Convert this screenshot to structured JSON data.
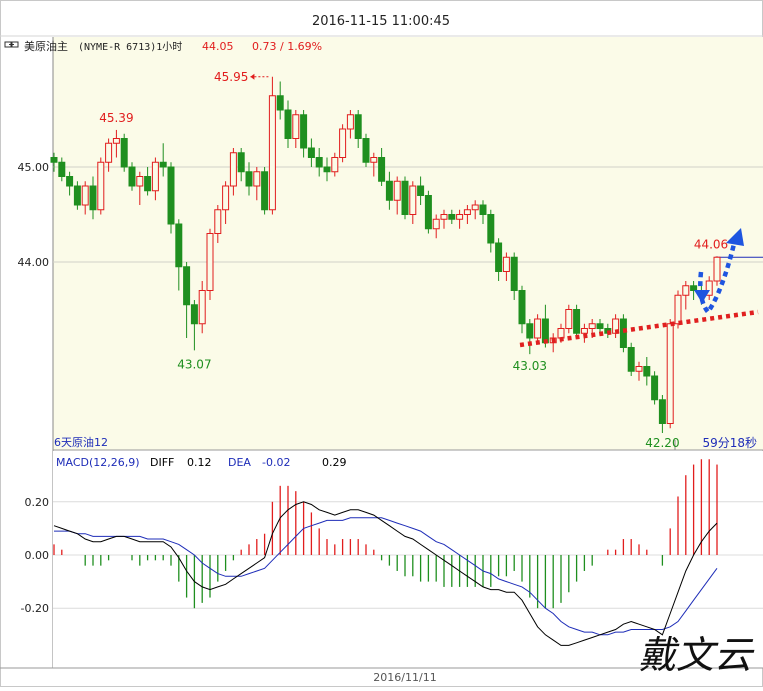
{
  "datetime": "2016-11-15 11:00:45",
  "header": {
    "instrument": "美原油主",
    "code": "(NYME-R 6713)1小时",
    "last_price": "44.05",
    "change": "0.73 / 1.69%"
  },
  "price_axis": {
    "ticks": [
      "45.00",
      "44.00"
    ]
  },
  "price_labels": {
    "p1": "45.39",
    "p2": "45.95",
    "p3": "43.07",
    "p4": "43.03",
    "p5": "42.20",
    "p6": "44.06"
  },
  "footer_left": "6天原油12",
  "countdown": "59分18秒",
  "macd": {
    "label": "MACD(12,26,9)",
    "diff_label": "DIFF",
    "diff_value": "0.12",
    "dea_label": "DEA",
    "dea_value": "-0.02",
    "macd_value": "0.29",
    "ticks": [
      "0.20",
      "0.00",
      "-0.20"
    ]
  },
  "date_label": "2016/11/11",
  "watermark": "戴文云",
  "colors": {
    "up": "#e11d1d",
    "down": "#1f8f1f",
    "diff": "#000000",
    "dea": "#1e2db8",
    "trend_up": "#e02020",
    "projection": "#1e55e0"
  },
  "chart_data": {
    "type": "candlestick",
    "title": "",
    "ylim": [
      42.0,
      46.0
    ],
    "grid": true,
    "levels": [
      45.0,
      44.0
    ],
    "candles": [
      [
        45.1,
        45.15,
        44.95,
        45.05
      ],
      [
        45.05,
        45.1,
        44.85,
        44.9
      ],
      [
        44.9,
        44.95,
        44.7,
        44.8
      ],
      [
        44.8,
        44.85,
        44.55,
        44.6
      ],
      [
        44.6,
        44.85,
        44.5,
        44.8
      ],
      [
        44.8,
        44.9,
        44.45,
        44.55
      ],
      [
        44.55,
        45.1,
        44.5,
        45.05
      ],
      [
        45.05,
        45.3,
        44.95,
        45.25
      ],
      [
        45.25,
        45.39,
        45.1,
        45.3
      ],
      [
        45.3,
        45.35,
        44.95,
        45.0
      ],
      [
        45.0,
        45.05,
        44.75,
        44.8
      ],
      [
        44.8,
        44.95,
        44.6,
        44.9
      ],
      [
        44.9,
        45.0,
        44.7,
        44.75
      ],
      [
        44.75,
        45.1,
        44.65,
        45.05
      ],
      [
        45.05,
        45.25,
        44.9,
        45.0
      ],
      [
        45.0,
        45.05,
        44.3,
        44.4
      ],
      [
        44.4,
        44.45,
        43.7,
        43.95
      ],
      [
        43.95,
        44.0,
        43.2,
        43.55
      ],
      [
        43.55,
        43.6,
        43.07,
        43.35
      ],
      [
        43.35,
        43.8,
        43.25,
        43.7
      ],
      [
        43.7,
        44.35,
        43.6,
        44.3
      ],
      [
        44.3,
        44.6,
        44.2,
        44.55
      ],
      [
        44.55,
        44.85,
        44.4,
        44.8
      ],
      [
        44.8,
        45.2,
        44.7,
        45.15
      ],
      [
        45.15,
        45.2,
        44.85,
        44.95
      ],
      [
        44.95,
        45.05,
        44.7,
        44.8
      ],
      [
        44.8,
        45.0,
        44.65,
        44.95
      ],
      [
        44.95,
        45.0,
        44.5,
        44.55
      ],
      [
        44.55,
        45.95,
        44.5,
        45.75
      ],
      [
        45.75,
        45.9,
        45.5,
        45.6
      ],
      [
        45.6,
        45.7,
        45.2,
        45.3
      ],
      [
        45.3,
        45.6,
        45.2,
        45.55
      ],
      [
        45.55,
        45.6,
        45.1,
        45.2
      ],
      [
        45.2,
        45.3,
        45.0,
        45.1
      ],
      [
        45.1,
        45.2,
        44.9,
        45.0
      ],
      [
        45.0,
        45.1,
        44.85,
        44.95
      ],
      [
        44.95,
        45.15,
        44.9,
        45.1
      ],
      [
        45.1,
        45.45,
        45.05,
        45.4
      ],
      [
        45.4,
        45.6,
        45.3,
        45.55
      ],
      [
        45.55,
        45.6,
        45.2,
        45.3
      ],
      [
        45.3,
        45.35,
        45.0,
        45.05
      ],
      [
        45.05,
        45.15,
        44.9,
        45.1
      ],
      [
        45.1,
        45.2,
        44.8,
        44.85
      ],
      [
        44.85,
        44.95,
        44.55,
        44.65
      ],
      [
        44.65,
        44.9,
        44.5,
        44.85
      ],
      [
        44.85,
        44.9,
        44.45,
        44.5
      ],
      [
        44.5,
        44.85,
        44.4,
        44.8
      ],
      [
        44.8,
        44.9,
        44.6,
        44.7
      ],
      [
        44.7,
        44.75,
        44.3,
        44.35
      ],
      [
        44.35,
        44.5,
        44.25,
        44.45
      ],
      [
        44.45,
        44.55,
        44.35,
        44.5
      ],
      [
        44.5,
        44.55,
        44.4,
        44.45
      ],
      [
        44.45,
        44.55,
        44.35,
        44.5
      ],
      [
        44.5,
        44.6,
        44.4,
        44.55
      ],
      [
        44.55,
        44.65,
        44.45,
        44.6
      ],
      [
        44.6,
        44.65,
        44.4,
        44.5
      ],
      [
        44.5,
        44.55,
        44.1,
        44.2
      ],
      [
        44.2,
        44.25,
        43.8,
        43.9
      ],
      [
        43.9,
        44.1,
        43.8,
        44.05
      ],
      [
        44.05,
        44.1,
        43.6,
        43.7
      ],
      [
        43.7,
        43.75,
        43.25,
        43.35
      ],
      [
        43.35,
        43.4,
        43.03,
        43.2
      ],
      [
        43.2,
        43.45,
        43.15,
        43.4
      ],
      [
        43.4,
        43.55,
        43.1,
        43.15
      ],
      [
        43.15,
        43.25,
        43.05,
        43.2
      ],
      [
        43.2,
        43.35,
        43.15,
        43.3
      ],
      [
        43.3,
        43.55,
        43.25,
        43.5
      ],
      [
        43.5,
        43.55,
        43.2,
        43.25
      ],
      [
        43.25,
        43.35,
        43.15,
        43.3
      ],
      [
        43.3,
        43.4,
        43.2,
        43.35
      ],
      [
        43.35,
        43.4,
        43.25,
        43.3
      ],
      [
        43.3,
        43.35,
        43.2,
        43.25
      ],
      [
        43.25,
        43.45,
        43.2,
        43.4
      ],
      [
        43.4,
        43.45,
        43.05,
        43.1
      ],
      [
        43.1,
        43.15,
        42.8,
        42.85
      ],
      [
        42.85,
        42.95,
        42.75,
        42.9
      ],
      [
        42.9,
        43.0,
        42.7,
        42.8
      ],
      [
        42.8,
        42.85,
        42.5,
        42.55
      ],
      [
        42.55,
        42.6,
        42.2,
        42.3
      ],
      [
        42.3,
        43.4,
        42.25,
        43.35
      ],
      [
        43.35,
        43.7,
        43.3,
        43.65
      ],
      [
        43.65,
        43.8,
        43.5,
        43.75
      ],
      [
        43.75,
        43.8,
        43.6,
        43.7
      ],
      [
        43.7,
        43.75,
        43.55,
        43.65
      ],
      [
        43.65,
        43.85,
        43.6,
        43.8
      ],
      [
        43.8,
        44.06,
        43.75,
        44.05
      ]
    ],
    "diff": [
      0.11,
      0.1,
      0.09,
      0.08,
      0.06,
      0.05,
      0.05,
      0.06,
      0.07,
      0.07,
      0.06,
      0.05,
      0.05,
      0.05,
      0.05,
      0.03,
      -0.01,
      -0.06,
      -0.1,
      -0.12,
      -0.13,
      -0.12,
      -0.11,
      -0.09,
      -0.07,
      -0.05,
      -0.03,
      -0.01,
      0.08,
      0.14,
      0.17,
      0.19,
      0.2,
      0.19,
      0.17,
      0.16,
      0.15,
      0.16,
      0.17,
      0.17,
      0.16,
      0.15,
      0.13,
      0.11,
      0.09,
      0.07,
      0.06,
      0.04,
      0.02,
      0.0,
      -0.02,
      -0.04,
      -0.06,
      -0.08,
      -0.1,
      -0.12,
      -0.13,
      -0.13,
      -0.14,
      -0.14,
      -0.17,
      -0.22,
      -0.27,
      -0.3,
      -0.32,
      -0.34,
      -0.34,
      -0.33,
      -0.32,
      -0.31,
      -0.3,
      -0.29,
      -0.28,
      -0.26,
      -0.25,
      -0.26,
      -0.27,
      -0.28,
      -0.3,
      -0.22,
      -0.14,
      -0.06,
      0.0,
      0.05,
      0.09,
      0.12
    ],
    "dea": [
      0.09,
      0.09,
      0.09,
      0.08,
      0.08,
      0.07,
      0.07,
      0.07,
      0.07,
      0.07,
      0.07,
      0.07,
      0.06,
      0.06,
      0.06,
      0.05,
      0.04,
      0.02,
      0.0,
      -0.03,
      -0.05,
      -0.07,
      -0.08,
      -0.08,
      -0.08,
      -0.07,
      -0.06,
      -0.05,
      -0.02,
      0.01,
      0.04,
      0.07,
      0.1,
      0.11,
      0.12,
      0.13,
      0.13,
      0.13,
      0.14,
      0.14,
      0.14,
      0.14,
      0.14,
      0.13,
      0.12,
      0.11,
      0.1,
      0.09,
      0.07,
      0.05,
      0.04,
      0.02,
      0.0,
      -0.02,
      -0.04,
      -0.06,
      -0.07,
      -0.09,
      -0.1,
      -0.11,
      -0.12,
      -0.14,
      -0.17,
      -0.2,
      -0.22,
      -0.25,
      -0.27,
      -0.28,
      -0.29,
      -0.29,
      -0.3,
      -0.3,
      -0.29,
      -0.29,
      -0.28,
      -0.28,
      -0.28,
      -0.28,
      -0.28,
      -0.27,
      -0.25,
      -0.21,
      -0.17,
      -0.13,
      -0.09,
      -0.05
    ]
  }
}
